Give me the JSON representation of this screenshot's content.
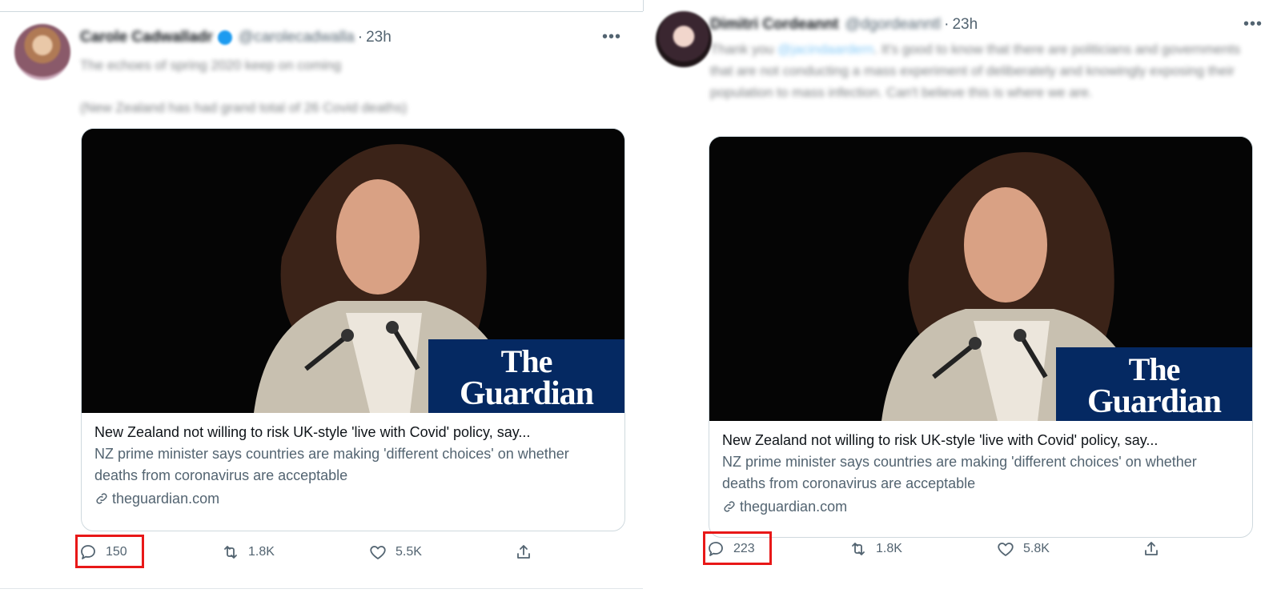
{
  "tweets": [
    {
      "author_name": "Carole Cadwalladr",
      "verified": true,
      "handle": "@carolecadwalla",
      "separator": "·",
      "time": "23h",
      "more_icon": "more-horizontal-icon",
      "text": [
        "The echoes of spring 2020 keep on coming",
        "(New Zealand has had grand total of 26 Covid deaths)"
      ],
      "card": {
        "image_logo_line1": "The",
        "image_logo_line2": "Guardian",
        "title": "New Zealand not willing to risk UK-style 'live with Covid' policy, say...",
        "description": "NZ prime minister says countries are making 'different choices' on whether deaths from coronavirus are acceptable",
        "domain": "theguardian.com"
      },
      "actions": {
        "reply_count": "150",
        "retweet_count": "1.8K",
        "like_count": "5.5K"
      },
      "highlighted_action": "reply"
    },
    {
      "author_name": "Dimitri Cordeannt",
      "verified": false,
      "handle": "@dgordeanntl",
      "separator": "·",
      "time": "23h",
      "more_icon": "more-horizontal-icon",
      "text_mention": "@jacindaardern",
      "text_pre": "Thank you ",
      "text_post": ". It's good to know that there are politicians and governments that are not conducting a mass experiment of deliberately and knowingly exposing their population to mass infection. Can't believe this is where we are.",
      "card": {
        "image_logo_line1": "The",
        "image_logo_line2": "Guardian",
        "title": "New Zealand not willing to risk UK-style 'live with Covid' policy, say...",
        "description": "NZ prime minister says countries are making 'different choices' on whether deaths from coronavirus are acceptable",
        "domain": "theguardian.com"
      },
      "actions": {
        "reply_count": "223",
        "retweet_count": "1.8K",
        "like_count": "5.8K"
      },
      "highlighted_action": "reply"
    }
  ],
  "colors": {
    "text_primary": "#0f1419",
    "text_secondary": "#536471",
    "border": "#cfd9de",
    "verified_badge": "#1d9bf0",
    "guardian_brand": "#052962",
    "highlight_box": "#e81818"
  }
}
